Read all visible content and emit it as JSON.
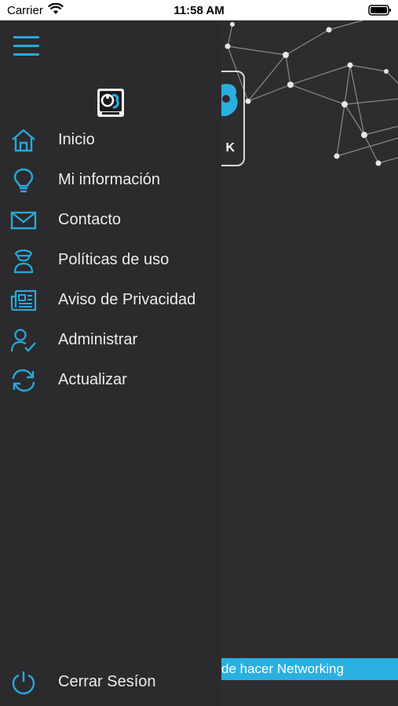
{
  "status_bar": {
    "carrier": "Carrier",
    "time": "11:58 AM"
  },
  "drawer": {
    "menu": [
      {
        "label": "Inicio",
        "icon": "home-icon"
      },
      {
        "label": "Mi información",
        "icon": "lightbulb-icon"
      },
      {
        "label": "Contacto",
        "icon": "envelope-icon"
      },
      {
        "label": "Políticas de uso",
        "icon": "officer-icon"
      },
      {
        "label": "Aviso de Privacidad",
        "icon": "newspaper-icon"
      },
      {
        "label": "Administrar",
        "icon": "user-check-icon"
      },
      {
        "label": "Actualizar",
        "icon": "refresh-icon"
      }
    ],
    "logout": {
      "label": "Cerrar Sesíon",
      "icon": "power-icon"
    }
  },
  "background": {
    "logo_fragment": "K",
    "ribbon_text": "de hacer Networking"
  },
  "colors": {
    "accent": "#29a8dc",
    "drawer_bg": "#2b2b2d",
    "ribbon": "#29b0e0"
  }
}
